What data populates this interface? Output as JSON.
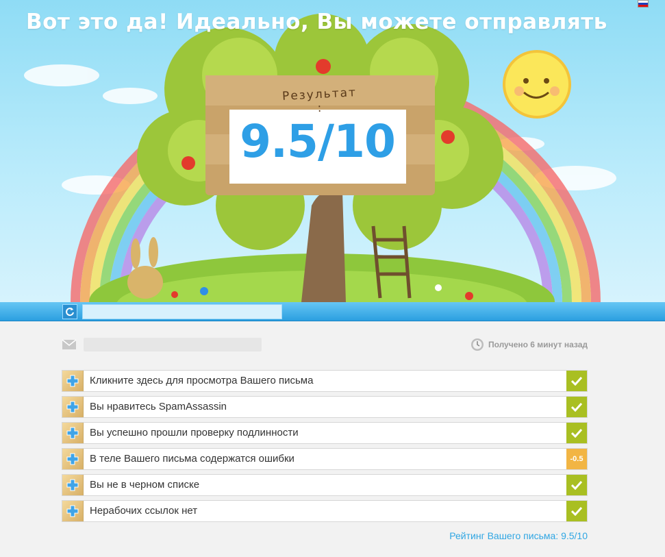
{
  "hero": {
    "title": "Вот это да! Идеально, Вы можете отправлять",
    "score_label": "Результат :",
    "score_value": "9.5/10",
    "lang_icon": "russian-flag-icon"
  },
  "urlbar": {
    "refresh_icon": "refresh-icon"
  },
  "meta": {
    "mail_icon": "envelope-icon",
    "clock_icon": "clock-icon",
    "received": "Получено 6 минут назад"
  },
  "checks": [
    {
      "label": "Кликните здесь для просмотра Вашего письма",
      "status": "ok"
    },
    {
      "label": "Вы нравитесь SpamAssassin",
      "status": "ok"
    },
    {
      "label": "Вы успешно прошли проверку подлинности",
      "status": "ok"
    },
    {
      "label": "В теле Вашего письма содержатся ошибки",
      "status": "warn",
      "penalty": "-0.5"
    },
    {
      "label": "Вы не в черном списке",
      "status": "ok"
    },
    {
      "label": "Нерабочих ссылок нет",
      "status": "ok"
    }
  ],
  "footer": {
    "rating": "Рейтинг Вашего письма: 9.5/10"
  },
  "colors": {
    "accent": "#2fa6e3",
    "ok": "#a9bf22",
    "warn": "#f2b544"
  }
}
